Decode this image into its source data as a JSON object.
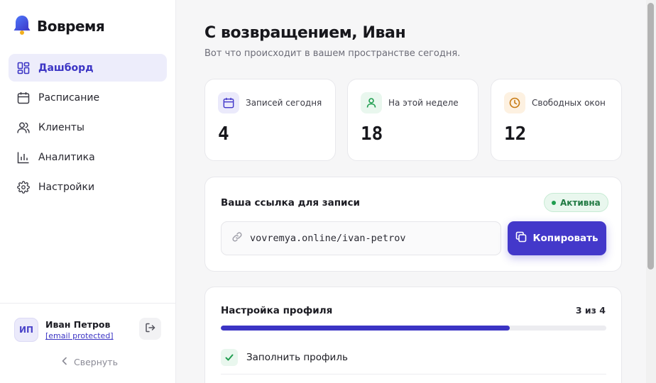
{
  "brand": {
    "name": "Вовремя"
  },
  "nav": [
    {
      "label": "Дашборд",
      "icon": "dashboard-icon",
      "active": true
    },
    {
      "label": "Расписание",
      "icon": "calendar-icon",
      "active": false
    },
    {
      "label": "Клиенты",
      "icon": "users-icon",
      "active": false
    },
    {
      "label": "Аналитика",
      "icon": "chart-icon",
      "active": false
    },
    {
      "label": "Настройки",
      "icon": "gear-icon",
      "active": false
    }
  ],
  "user": {
    "initials": "ИП",
    "name": "Иван Петров",
    "email": "[email protected]"
  },
  "sidebar": {
    "collapse_label": "Свернуть"
  },
  "header": {
    "greeting": "С возвращением, Иван",
    "subtitle": "Вот что происходит в вашем пространстве сегодня."
  },
  "stats": [
    {
      "label": "Записей сегодня",
      "value": "4",
      "icon": "calendar-icon",
      "color": "#4338ca",
      "bg": "#ebeafb"
    },
    {
      "label": "На этой неделе",
      "value": "18",
      "icon": "user-icon",
      "color": "#1f9d4f",
      "bg": "#e9f7ee"
    },
    {
      "label": "Свободных окон",
      "value": "12",
      "icon": "clock-icon",
      "color": "#c77a12",
      "bg": "#fdf1e1"
    }
  ],
  "booking_link": {
    "title": "Ваша ссылка для записи",
    "status": "Активна",
    "url": "vovremya.online/ivan-petrov",
    "copy_label": "Копировать"
  },
  "profile_setup": {
    "title": "Настройка профиля",
    "progress_text": "3 из 4",
    "progress_fraction": 0.75,
    "items": [
      {
        "label": "Заполнить профиль",
        "done": true
      }
    ]
  },
  "colors": {
    "accent": "#4338ca",
    "success": "#1f9d4f"
  }
}
